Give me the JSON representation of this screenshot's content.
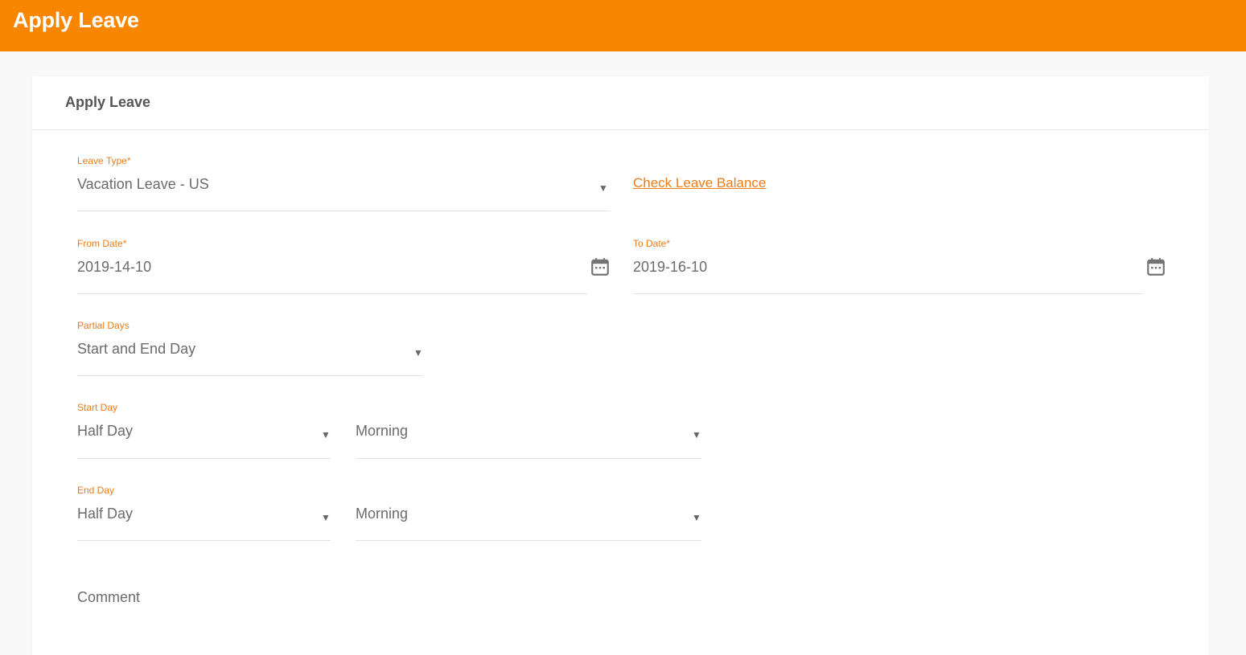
{
  "header": {
    "title": "Apply Leave"
  },
  "card": {
    "title": "Apply Leave"
  },
  "leave_type": {
    "label": "Leave Type",
    "required_mark": "*",
    "value": "Vacation Leave - US"
  },
  "check_balance_link": "Check Leave Balance",
  "from_date": {
    "label": "From Date",
    "required_mark": "*",
    "value": "2019-14-10",
    "icon": "calendar-icon"
  },
  "to_date": {
    "label": "To Date",
    "required_mark": "*",
    "value": "2019-16-10",
    "icon": "calendar-icon"
  },
  "partial_days": {
    "label": "Partial Days",
    "value": "Start and End Day"
  },
  "start_day": {
    "label": "Start Day",
    "duration": "Half Day",
    "period": "Morning"
  },
  "end_day": {
    "label": "End Day",
    "duration": "Half Day",
    "period": "Morning"
  },
  "comment": {
    "placeholder": "Comment"
  },
  "colors": {
    "accent": "#f88600",
    "label": "#ea7d1a",
    "text": "#6b6b6b"
  }
}
